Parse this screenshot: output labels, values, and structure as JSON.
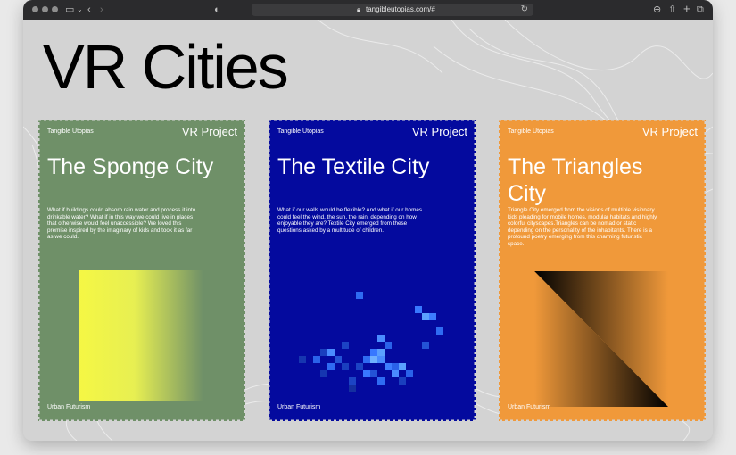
{
  "browser": {
    "url": "tangibleutopias.com/#"
  },
  "page": {
    "hero_title": "VR Cities"
  },
  "cards": [
    {
      "top_left": "Tangible Utopias",
      "top_right": "VR Project",
      "title": "The Sponge City",
      "description": "What if buildings could absorb rain water and process it into drinkable water? What if in this way we could live in places that otherwise would feel unaccessible? We loved this premise inspired by the imaginary of kids and took it as far as we could.",
      "bottom_left": "Urban Futurism",
      "background": "#6f9068",
      "text_color": "#ffffff"
    },
    {
      "top_left": "Tangible Utopias",
      "top_right": "VR Project",
      "title": "The Textile City",
      "description": "What if our walls would be flexible? And what if our homes could feel the wind, the sun, the rain, depending on how enjoyable they are? Textile City emerged from these questions asked by a multitude of children.",
      "bottom_left": "Urban Futurism",
      "background": "#040a9e",
      "text_color": "#ffffff"
    },
    {
      "top_left": "Tangible Utopias",
      "top_right": "VR Project",
      "title": "The Triangles City",
      "description": "Triangle City emerged from the visions of multiple visionary kids pleading for mobile homes, modular habitats and highly colorful cityscapes.Triangles can be nomad or static depending on the personality of the inhabitants. There is a profound poetry emerging from this charming futuristic space.",
      "bottom_left": "Urban Futurism",
      "background": "#f0993a",
      "text_color": "#ffffff"
    }
  ]
}
